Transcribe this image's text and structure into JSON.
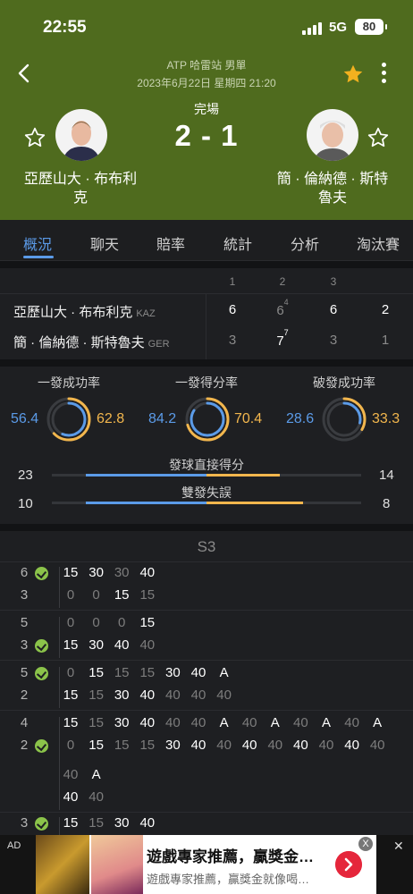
{
  "status_bar": {
    "time": "22:55",
    "network": "5G",
    "battery": "80"
  },
  "header": {
    "competition": "ATP 哈雷站 男單",
    "datetime": "2023年6月22日 星期四 21:20",
    "match_status": "完場",
    "score": "2 - 1",
    "player1": {
      "name_line1": "亞歷山大 · 布布利",
      "name_line2": "克"
    },
    "player2": {
      "name_line1": "簡 · 倫納德 · 斯特",
      "name_line2": "魯夫"
    }
  },
  "tabs": [
    "概況",
    "聊天",
    "賠率",
    "統計",
    "分析",
    "淘汰賽"
  ],
  "sets_table": {
    "set_headers": [
      "1",
      "2",
      "3"
    ],
    "rows": [
      {
        "name": "亞歷山大 · 布布利克",
        "country": "KAZ",
        "s1": "6",
        "s2": "6",
        "s2_tb": "4",
        "s3": "6",
        "total": "2"
      },
      {
        "name": "簡 · 倫納德 · 斯特魯夫",
        "country": "GER",
        "s1": "3",
        "s2": "7",
        "s2_tb": "7",
        "s3": "3",
        "total": "1"
      }
    ]
  },
  "stats": {
    "rings": [
      {
        "title": "一發成功率",
        "left": "56.4",
        "right": "62.8",
        "left_pct": 56.4,
        "right_pct": 62.8
      },
      {
        "title": "一發得分率",
        "left": "84.2",
        "right": "70.4",
        "left_pct": 84.2,
        "right_pct": 70.4
      },
      {
        "title": "破發成功率",
        "left": "28.6",
        "right": "33.3",
        "left_pct": 28.6,
        "right_pct": 33.3
      }
    ],
    "bars": [
      {
        "title": "發球直接得分",
        "left": "23",
        "right": "14",
        "left_val": 23,
        "right_val": 14
      },
      {
        "title": "雙發失誤",
        "left": "10",
        "right": "8",
        "left_val": 10,
        "right_val": 8
      }
    ]
  },
  "point_by_point": {
    "set_label": "S3",
    "games": [
      {
        "top_score": "6",
        "bottom_score": "3",
        "server": "top",
        "top": [
          "15",
          "30",
          "30",
          "40"
        ],
        "bottom": [
          "0",
          "0",
          "15",
          "15"
        ],
        "top_w": [
          1,
          1,
          0,
          1
        ],
        "bottom_w": [
          0,
          0,
          1,
          0
        ]
      },
      {
        "top_score": "5",
        "bottom_score": "3",
        "server": "bottom",
        "top": [
          "0",
          "0",
          "0",
          "15"
        ],
        "bottom": [
          "15",
          "30",
          "40",
          "40"
        ],
        "top_w": [
          0,
          0,
          0,
          1
        ],
        "bottom_w": [
          1,
          1,
          1,
          0
        ]
      },
      {
        "top_score": "5",
        "bottom_score": "2",
        "server": "top",
        "top": [
          "0",
          "15",
          "15",
          "15",
          "30",
          "40",
          "A"
        ],
        "bottom": [
          "15",
          "15",
          "30",
          "40",
          "40",
          "40",
          "40"
        ],
        "top_w": [
          0,
          1,
          0,
          0,
          1,
          1,
          1
        ],
        "bottom_w": [
          1,
          0,
          1,
          1,
          0,
          0,
          0
        ]
      },
      {
        "top_score": "4",
        "bottom_score": "2",
        "server": "bottom",
        "top": [
          "15",
          "15",
          "30",
          "40",
          "40",
          "40",
          "A",
          "40",
          "A",
          "40",
          "A",
          "40",
          "A"
        ],
        "bottom": [
          "0",
          "15",
          "15",
          "15",
          "30",
          "40",
          "40",
          "40",
          "40",
          "40",
          "40",
          "40",
          "40"
        ],
        "top_w": [
          1,
          0,
          1,
          1,
          0,
          0,
          1,
          0,
          1,
          0,
          1,
          0,
          1
        ],
        "bottom_w": [
          0,
          1,
          0,
          0,
          1,
          1,
          0,
          1,
          0,
          1,
          0,
          1,
          0
        ],
        "top_wrap": [
          "40",
          "A"
        ],
        "bottom_wrap": [
          "40",
          "40"
        ],
        "top_wrap_w": [
          0,
          1
        ],
        "bottom_wrap_w": [
          1,
          0
        ]
      },
      {
        "top_score": "3",
        "bottom_score": "",
        "server": "top",
        "top": [
          "15",
          "15",
          "30",
          "40"
        ],
        "bottom": [],
        "top_w": [
          1,
          0,
          1,
          1
        ],
        "bottom_w": []
      }
    ]
  },
  "ad": {
    "label": "AD",
    "close": "✕",
    "title": "遊戲專家推薦，贏獎金…",
    "subtitle": "遊戲專家推薦，贏獎金就像喝…",
    "badge": "X"
  },
  "colors": {
    "header_bg": "#4f6b1e",
    "accent_blue": "#5b9be8",
    "accent_orange": "#f2b64d",
    "favorite_star": "#f2b11f"
  }
}
